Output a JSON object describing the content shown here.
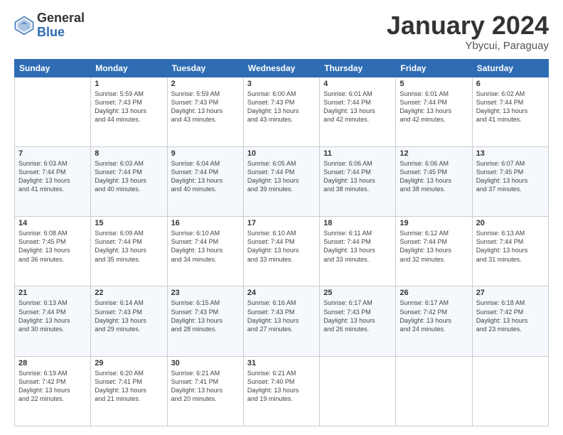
{
  "logo": {
    "general": "General",
    "blue": "Blue"
  },
  "title": "January 2024",
  "subtitle": "Ybycui, Paraguay",
  "days_of_week": [
    "Sunday",
    "Monday",
    "Tuesday",
    "Wednesday",
    "Thursday",
    "Friday",
    "Saturday"
  ],
  "weeks": [
    [
      {
        "day": "",
        "info": ""
      },
      {
        "day": "1",
        "info": "Sunrise: 5:59 AM\nSunset: 7:43 PM\nDaylight: 13 hours\nand 44 minutes."
      },
      {
        "day": "2",
        "info": "Sunrise: 5:59 AM\nSunset: 7:43 PM\nDaylight: 13 hours\nand 43 minutes."
      },
      {
        "day": "3",
        "info": "Sunrise: 6:00 AM\nSunset: 7:43 PM\nDaylight: 13 hours\nand 43 minutes."
      },
      {
        "day": "4",
        "info": "Sunrise: 6:01 AM\nSunset: 7:44 PM\nDaylight: 13 hours\nand 42 minutes."
      },
      {
        "day": "5",
        "info": "Sunrise: 6:01 AM\nSunset: 7:44 PM\nDaylight: 13 hours\nand 42 minutes."
      },
      {
        "day": "6",
        "info": "Sunrise: 6:02 AM\nSunset: 7:44 PM\nDaylight: 13 hours\nand 41 minutes."
      }
    ],
    [
      {
        "day": "7",
        "info": "Sunrise: 6:03 AM\nSunset: 7:44 PM\nDaylight: 13 hours\nand 41 minutes."
      },
      {
        "day": "8",
        "info": "Sunrise: 6:03 AM\nSunset: 7:44 PM\nDaylight: 13 hours\nand 40 minutes."
      },
      {
        "day": "9",
        "info": "Sunrise: 6:04 AM\nSunset: 7:44 PM\nDaylight: 13 hours\nand 40 minutes."
      },
      {
        "day": "10",
        "info": "Sunrise: 6:05 AM\nSunset: 7:44 PM\nDaylight: 13 hours\nand 39 minutes."
      },
      {
        "day": "11",
        "info": "Sunrise: 6:06 AM\nSunset: 7:44 PM\nDaylight: 13 hours\nand 38 minutes."
      },
      {
        "day": "12",
        "info": "Sunrise: 6:06 AM\nSunset: 7:45 PM\nDaylight: 13 hours\nand 38 minutes."
      },
      {
        "day": "13",
        "info": "Sunrise: 6:07 AM\nSunset: 7:45 PM\nDaylight: 13 hours\nand 37 minutes."
      }
    ],
    [
      {
        "day": "14",
        "info": "Sunrise: 6:08 AM\nSunset: 7:45 PM\nDaylight: 13 hours\nand 36 minutes."
      },
      {
        "day": "15",
        "info": "Sunrise: 6:09 AM\nSunset: 7:44 PM\nDaylight: 13 hours\nand 35 minutes."
      },
      {
        "day": "16",
        "info": "Sunrise: 6:10 AM\nSunset: 7:44 PM\nDaylight: 13 hours\nand 34 minutes."
      },
      {
        "day": "17",
        "info": "Sunrise: 6:10 AM\nSunset: 7:44 PM\nDaylight: 13 hours\nand 33 minutes."
      },
      {
        "day": "18",
        "info": "Sunrise: 6:11 AM\nSunset: 7:44 PM\nDaylight: 13 hours\nand 33 minutes."
      },
      {
        "day": "19",
        "info": "Sunrise: 6:12 AM\nSunset: 7:44 PM\nDaylight: 13 hours\nand 32 minutes."
      },
      {
        "day": "20",
        "info": "Sunrise: 6:13 AM\nSunset: 7:44 PM\nDaylight: 13 hours\nand 31 minutes."
      }
    ],
    [
      {
        "day": "21",
        "info": "Sunrise: 6:13 AM\nSunset: 7:44 PM\nDaylight: 13 hours\nand 30 minutes."
      },
      {
        "day": "22",
        "info": "Sunrise: 6:14 AM\nSunset: 7:43 PM\nDaylight: 13 hours\nand 29 minutes."
      },
      {
        "day": "23",
        "info": "Sunrise: 6:15 AM\nSunset: 7:43 PM\nDaylight: 13 hours\nand 28 minutes."
      },
      {
        "day": "24",
        "info": "Sunrise: 6:16 AM\nSunset: 7:43 PM\nDaylight: 13 hours\nand 27 minutes."
      },
      {
        "day": "25",
        "info": "Sunrise: 6:17 AM\nSunset: 7:43 PM\nDaylight: 13 hours\nand 26 minutes."
      },
      {
        "day": "26",
        "info": "Sunrise: 6:17 AM\nSunset: 7:42 PM\nDaylight: 13 hours\nand 24 minutes."
      },
      {
        "day": "27",
        "info": "Sunrise: 6:18 AM\nSunset: 7:42 PM\nDaylight: 13 hours\nand 23 minutes."
      }
    ],
    [
      {
        "day": "28",
        "info": "Sunrise: 6:19 AM\nSunset: 7:42 PM\nDaylight: 13 hours\nand 22 minutes."
      },
      {
        "day": "29",
        "info": "Sunrise: 6:20 AM\nSunset: 7:41 PM\nDaylight: 13 hours\nand 21 minutes."
      },
      {
        "day": "30",
        "info": "Sunrise: 6:21 AM\nSunset: 7:41 PM\nDaylight: 13 hours\nand 20 minutes."
      },
      {
        "day": "31",
        "info": "Sunrise: 6:21 AM\nSunset: 7:40 PM\nDaylight: 13 hours\nand 19 minutes."
      },
      {
        "day": "",
        "info": ""
      },
      {
        "day": "",
        "info": ""
      },
      {
        "day": "",
        "info": ""
      }
    ]
  ]
}
